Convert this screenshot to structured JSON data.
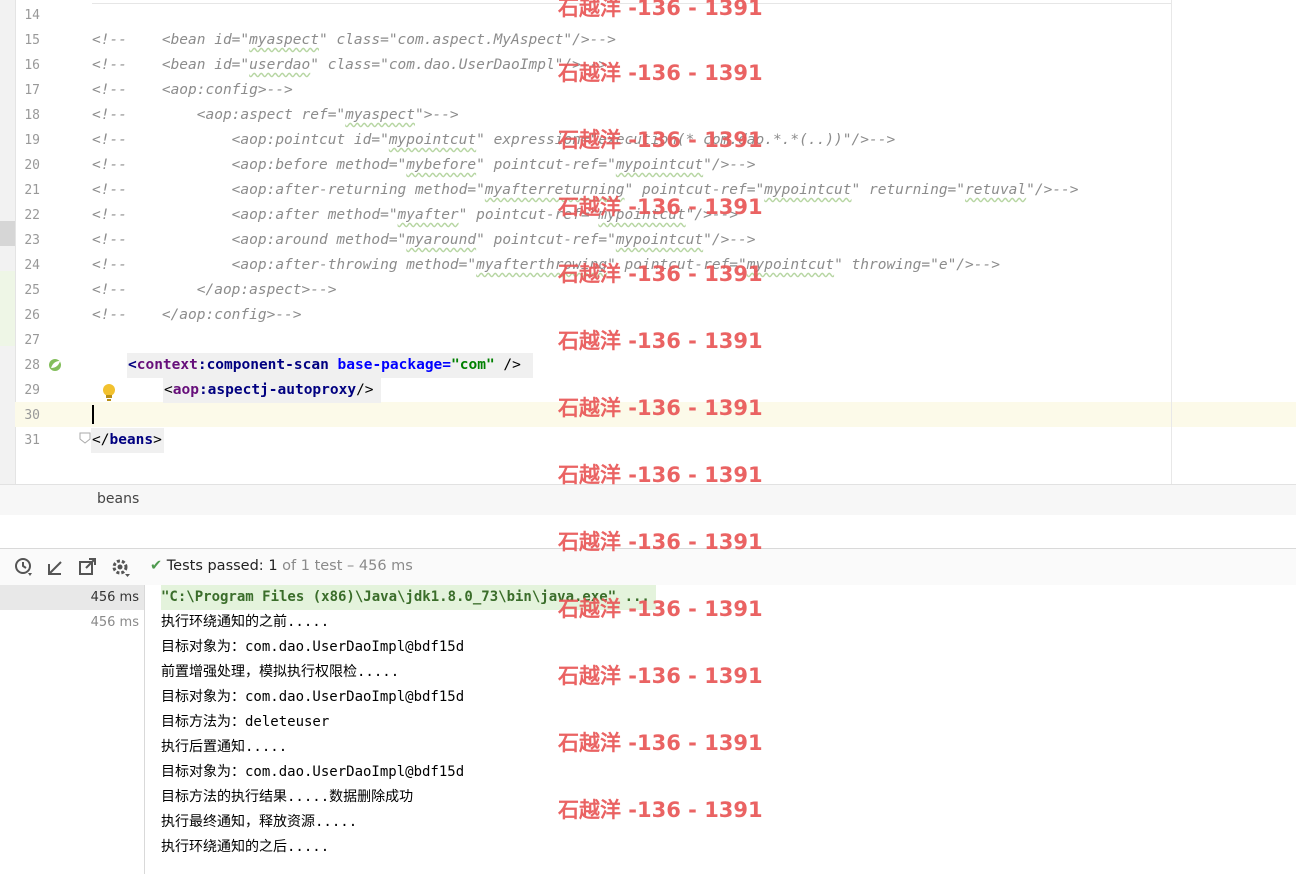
{
  "editor": {
    "line_numbers": [
      "14",
      "15",
      "16",
      "17",
      "18",
      "19",
      "20",
      "21",
      "22",
      "23",
      "24",
      "25",
      "26",
      "27",
      "28",
      "29",
      "30",
      "31"
    ],
    "comment_prefix": "<!--",
    "lines": {
      "l15": {
        "a": "    <bean id=\"",
        "v1": "myaspect",
        "b": "\" class=\"com.aspect.MyAspect\"/>-->"
      },
      "l16": {
        "a": "    <bean id=\"",
        "v1": "userdao",
        "b": "\" class=\"com.dao.UserDaoImpl\"/>-->"
      },
      "l17": {
        "a": "    <aop:config>-->"
      },
      "l18": {
        "a": "        <aop:aspect ref=\"",
        "v1": "myaspect",
        "b": "\">-->"
      },
      "l19": {
        "a": "            <aop:pointcut id=\"",
        "v1": "mypointcut",
        "b": "\" expression=\"execution(* com.dao.*.*(..))\"/>-->"
      },
      "l20": {
        "a": "            <aop:before method=\"",
        "v1": "mybefore",
        "b": "\" pointcut-ref=\"",
        "v2": "mypointcut",
        "c": "\"/>-->"
      },
      "l21": {
        "a": "            <aop:after-returning method=\"",
        "v1": "myafterreturning",
        "b": "\" pointcut-ref=\"",
        "v2": "mypointcut",
        "c": "\" returning=\"",
        "v3": "retuval",
        "d": "\"/>-->"
      },
      "l22": {
        "a": "            <aop:after method=\"",
        "v1": "myafter",
        "b": "\" pointcut-ref=\"",
        "v2": "mypointcut",
        "c": "\"/>-->"
      },
      "l23": {
        "a": "            <aop:around method=\"",
        "v1": "myaround",
        "b": "\" pointcut-ref=\"",
        "v2": "mypointcut",
        "c": "\"/>-->"
      },
      "l24": {
        "a": "            <aop:after-throwing method=\"",
        "v1": "myafterthrowing",
        "b": "\" pointcut-ref=\"",
        "v2": "mypointcut",
        "c": "\" throwing=\"e\"/>-->"
      },
      "l25": {
        "a": "        </aop:aspect>-->"
      },
      "l26": {
        "a": "    </aop:config>-->"
      },
      "l28": {
        "open": "<",
        "ns": "context",
        "colon": ":",
        "tag": "component-scan",
        "sp": " ",
        "attr": "base-package",
        "eq": "=",
        "str": "\"com\"",
        "close": " />"
      },
      "l29": {
        "open": "<",
        "ns": "aop",
        "colon": ":",
        "tag": "aspectj-autoproxy",
        "close": "/>"
      },
      "l31": {
        "open": "</",
        "tag": "beans",
        "close": ">"
      }
    }
  },
  "breadcrumb": {
    "label": "beans"
  },
  "run_toolbar": {
    "status_check": "✔",
    "status_label": "Tests passed:",
    "status_count": "1",
    "status_rest": "of 1 test – 456 ms",
    "icons": [
      "history-icon",
      "import-tests-icon",
      "export-tests-icon",
      "settings-gear-icon"
    ]
  },
  "test_tree": {
    "rows": [
      "456 ms",
      "456 ms"
    ]
  },
  "console": {
    "lines": [
      "\"C:\\Program Files (x86)\\Java\\jdk1.8.0_73\\bin\\java.exe\" ...",
      "执行环绕通知的之前.....",
      "目标对象为：com.dao.UserDaoImpl@bdf15d",
      "前置增强处理，模拟执行权限检.....",
      "目标对象为：com.dao.UserDaoImpl@bdf15d",
      "目标方法为：deleteuser",
      "执行后置通知.....",
      "目标对象为：com.dao.UserDaoImpl@bdf15d",
      "目标方法的执行结果.....数据删除成功",
      "执行最终通知，释放资源.....",
      "执行环绕通知的之后....."
    ]
  },
  "watermark": {
    "text": "石越洋 -136 - 1391"
  },
  "colors": {
    "comment": "#8c8c8c",
    "tag": "#000080",
    "attr": "#0000ff",
    "string": "#008000",
    "current_line": "#fcfae9",
    "watermark": "#e85656"
  }
}
